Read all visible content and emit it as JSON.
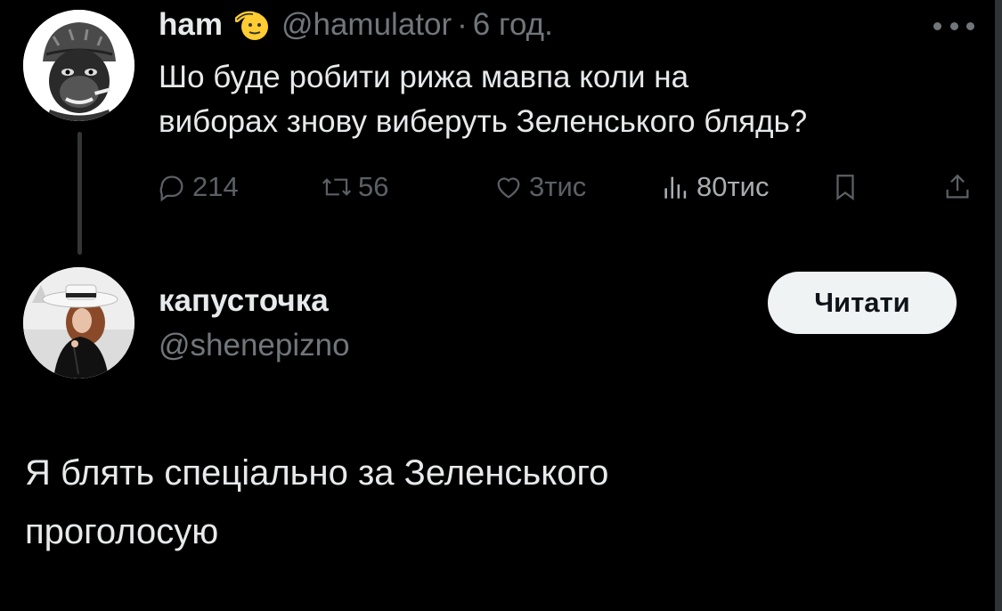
{
  "original_tweet": {
    "author_name": "ham",
    "handle": "@hamulator",
    "separator": "·",
    "time": "6 год.",
    "text": "Шо буде робити рижа мавпа коли на\nвиборах знову виберуть Зеленського блядь?",
    "stats": {
      "replies": "214",
      "retweets": "56",
      "likes": "3тис",
      "views": "80тис"
    },
    "icons": {
      "badge": "saluting-face-emoji-icon",
      "more": "more-options-icon",
      "reply": "reply-icon",
      "retweet": "retweet-icon",
      "like": "heart-icon",
      "views": "views-chart-icon",
      "bookmark": "bookmark-icon",
      "share": "share-icon"
    }
  },
  "reply": {
    "author_name": "капусточка",
    "handle": "@shenepizno",
    "follow_label": "Читати",
    "text": "Я блять спеціально за Зеленського\nпроголосую"
  },
  "colors": {
    "background": "#000000",
    "primary_text": "#e7e9ea",
    "secondary_text": "#71767b",
    "button_bg": "#eff3f4"
  }
}
